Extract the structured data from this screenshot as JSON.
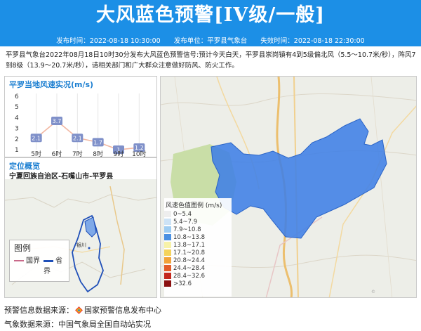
{
  "header": {
    "title": "大风蓝色预警[IV级/一般]",
    "publish_time": "发布时间：2022-08-18 10:30:00",
    "publisher": "发布单位：平罗县气象台",
    "expire_time": "失效时间：2022-08-18 22:30:00"
  },
  "description": "平罗县气象台2022年08月18日10时30分发布大风蓝色预警信号:预计今天白天，平罗县崇岗镇有4到5级偏北风（5.5～10.7米/秒），阵风7到8级（13.9～20.7米/秒），请相关部门和广大群众注意做好防风、防火工作。",
  "wind_panel": {
    "title": "平罗当地风速实况(m/s)"
  },
  "chart_data": {
    "type": "line",
    "title": "平罗当地风速实况(m/s)",
    "categories": [
      "5时",
      "6时",
      "7时",
      "8时",
      "9时",
      "10时"
    ],
    "values": [
      2.1,
      3.7,
      2.1,
      1.7,
      1,
      1.2
    ],
    "labels": [
      "2.1",
      "3.7",
      "2.1",
      "1.7",
      "1",
      "1.2"
    ],
    "ylim": [
      1,
      6
    ],
    "yticks": [
      "1",
      "2",
      "3",
      "4",
      "5",
      "6"
    ],
    "line_color": "#f2b8a3",
    "marker_color": "#7f90c9"
  },
  "location_panel": {
    "title": "定位概览",
    "path": "宁夏回族自治区-石嘴山市-平罗县",
    "city_label": "银川",
    "legend_title": "图例",
    "legend_items": [
      {
        "label": "国界",
        "color": "#c96a8a"
      },
      {
        "label": "省界",
        "color": "#1f4fb8"
      }
    ]
  },
  "map_panel": {
    "legend_title": "风速色值图例 (m/s)",
    "legend": [
      {
        "label": "0~5.4",
        "color": "#eeeeee"
      },
      {
        "label": "5.4~7.9",
        "color": "#cde3f6"
      },
      {
        "label": "7.9~10.8",
        "color": "#9fcdf2"
      },
      {
        "label": "10.8~13.8",
        "color": "#4a90e2"
      },
      {
        "label": "13.8~17.1",
        "color": "#f7f2a8"
      },
      {
        "label": "17.1~20.8",
        "color": "#f4d35b"
      },
      {
        "label": "20.8~24.4",
        "color": "#f2a33a"
      },
      {
        "label": "24.4~28.4",
        "color": "#e35d2a"
      },
      {
        "label": "28.4~32.6",
        "color": "#c4271d"
      },
      {
        "label": ">32.6",
        "color": "#8a1010"
      }
    ],
    "warning_color": "#3f7fe6"
  },
  "footer": {
    "source1_label": "预警信息数据来源：",
    "source1_value": "国家预警信息发布中心",
    "source2_label": "气象数据来源：",
    "source2_value": "中国气象局全国自动站实况"
  }
}
